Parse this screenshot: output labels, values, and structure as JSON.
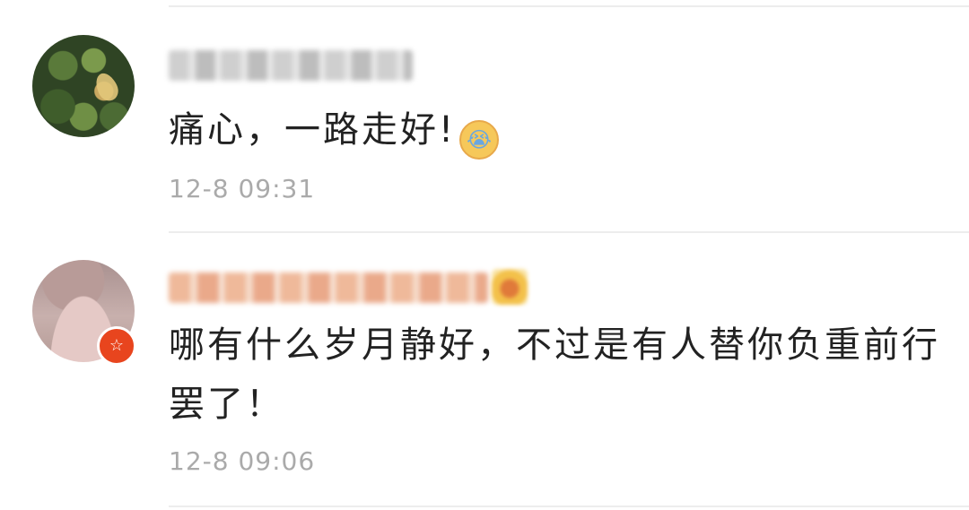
{
  "comments": [
    {
      "username": "",
      "text": "痛心，一路走好!",
      "emoji": "loudly-crying-face",
      "time": "12-8 09:31"
    },
    {
      "username": "",
      "text": "哪有什么岁月静好，不过是有人替你负重前行罢了！",
      "badge": "☆",
      "time": "12-8 09:06"
    }
  ],
  "colors": {
    "text": "#222222",
    "timestamp": "#aaaaaa",
    "divider": "#ededed",
    "badge": "#e8451e"
  }
}
